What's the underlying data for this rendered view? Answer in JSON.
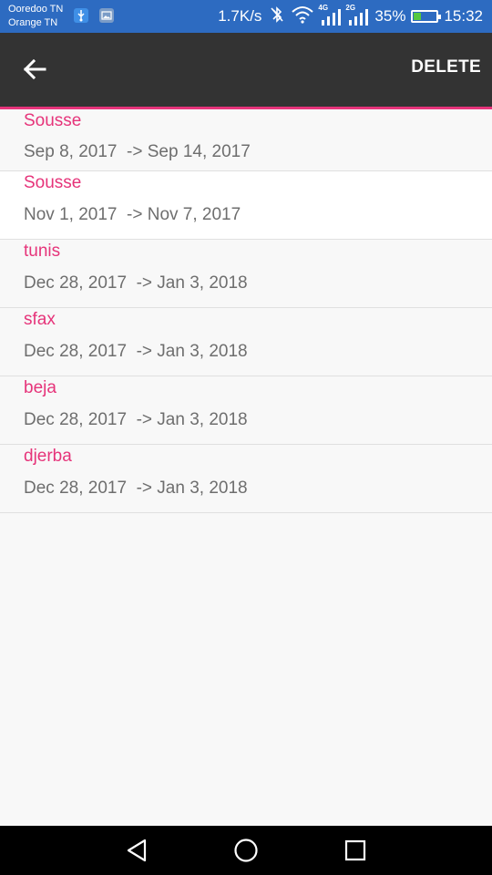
{
  "status_bar": {
    "carrier_1": "Ooredoo TN",
    "carrier_2": "Orange TN",
    "net_speed": "1.7K/s",
    "net_1_tag": "4G",
    "net_2_tag": "2G",
    "battery_percent": "35%",
    "battery_level": 0.35,
    "time": "15:32",
    "icons": [
      "usb-icon",
      "image-icon",
      "bluetooth-off-icon",
      "wifi-icon",
      "signal-icon",
      "battery-charging-icon"
    ]
  },
  "app_bar": {
    "back_icon": "arrow-back-icon",
    "delete_label": "DELETE",
    "accent_color": "#e6347a",
    "background_color": "#333333"
  },
  "trips": [
    {
      "city": "Sousse",
      "dates": "Sep 8, 2017  -> Sep 14, 2017"
    },
    {
      "city": "Sousse",
      "dates": "Nov 1, 2017  -> Nov 7, 2017"
    },
    {
      "city": "tunis",
      "dates": "Dec 28, 2017  -> Jan 3, 2018"
    },
    {
      "city": "sfax",
      "dates": "Dec 28, 2017  -> Jan 3, 2018"
    },
    {
      "city": "beja",
      "dates": "Dec 28, 2017  -> Jan 3, 2018"
    },
    {
      "city": "djerba",
      "dates": "Dec 28, 2017  -> Jan 3, 2018"
    }
  ],
  "nav_bar": {
    "icons": [
      "nav-back-icon",
      "nav-home-icon",
      "nav-recent-icon"
    ]
  }
}
